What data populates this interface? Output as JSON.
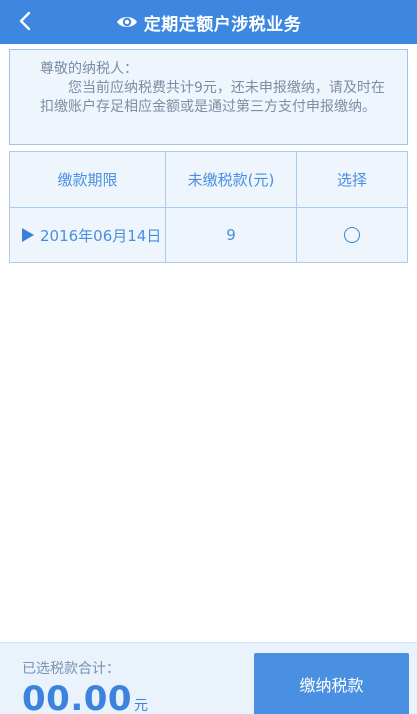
{
  "header": {
    "title": "定期定额户涉税业务",
    "back_icon": "chevron-left-icon",
    "title_icon": "eye-icon"
  },
  "notice": {
    "greeting": "尊敬的纳税人：",
    "message": "您当前应纳税费共计9元，还未申报缴纳，请及时在扣缴账户存足相应金额或是通过第三方支付申报缴纳。"
  },
  "table": {
    "headers": [
      "缴款期限",
      "未缴税款(元)",
      "选择"
    ],
    "rows": [
      {
        "date": "2016年06月14日",
        "amount": "9",
        "selected": false
      }
    ]
  },
  "footer": {
    "sum_label": "已选税款合计：",
    "sum_value": "00.00",
    "sum_unit": "元",
    "pay_label": "缴纳税款"
  },
  "colors": {
    "primary": "#3d87e0",
    "panel_bg": "#eef5fd",
    "border": "#a9ccef",
    "text_blue": "#4a8ee0"
  }
}
